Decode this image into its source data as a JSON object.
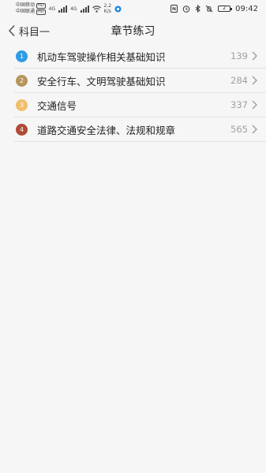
{
  "status_bar": {
    "carrier_1": "中国移动",
    "carrier_2": "中国联通",
    "hd_1": "HD",
    "hd_2": "HD",
    "network_1": "4G",
    "network_2": "4G",
    "speed_value": "2.2",
    "speed_unit": "K/s",
    "battery": "2",
    "time": "09:42"
  },
  "header": {
    "back_label": "科目一",
    "title": "章节练习"
  },
  "chapters": [
    {
      "index": "1",
      "name": "机动车驾驶操作相关基础知识",
      "count": "139",
      "color": "#2f9be4"
    },
    {
      "index": "2",
      "name": "安全行车、文明驾驶基础知识",
      "count": "284",
      "color": "#b7955b"
    },
    {
      "index": "3",
      "name": "交通信号",
      "count": "337",
      "color": "#f1be6a"
    },
    {
      "index": "4",
      "name": "道路交通安全法律、法规和规章",
      "count": "565",
      "color": "#b04a36"
    }
  ]
}
